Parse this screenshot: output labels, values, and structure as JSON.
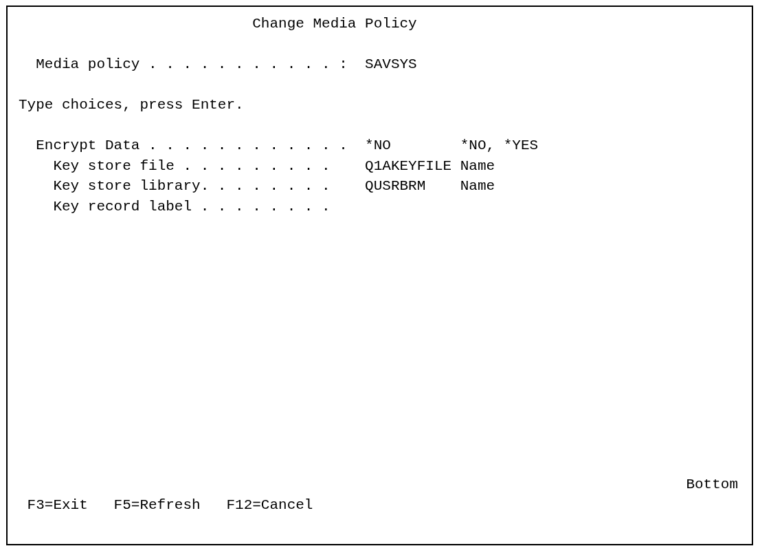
{
  "title": "Change Media Policy",
  "media_policy": {
    "label": "Media policy . . . . . . . . . . . :",
    "value": "SAVSYS"
  },
  "instruction": "Type choices, press Enter.",
  "fields": [
    {
      "label": "Encrypt Data . . . . . . . . . . . .",
      "value": "*NO",
      "hint": "*NO, *YES",
      "children": [
        {
          "label": "Key store file . . . . . . . . .",
          "value": "Q1AKEYFILE",
          "hint": "Name"
        },
        {
          "label": "Key store library. . . . . . . .",
          "value": "QUSRBRM",
          "hint": "Name"
        },
        {
          "label": "Key record label . . . . . . . ."
        }
      ]
    }
  ],
  "more_indicator": "Bottom",
  "function_keys": [
    "F3=Exit",
    "F5=Refresh",
    "F12=Cancel"
  ]
}
